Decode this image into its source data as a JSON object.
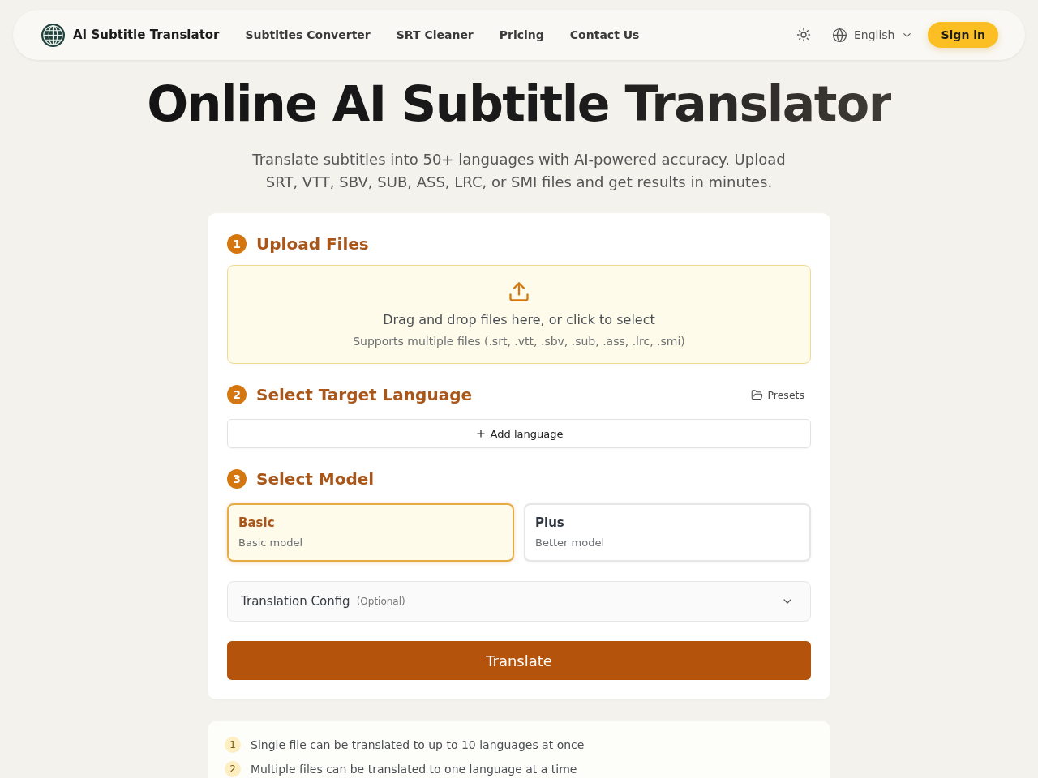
{
  "header": {
    "brand": "AI Subtitle Translator",
    "nav": [
      "Subtitles Converter",
      "SRT Cleaner",
      "Pricing",
      "Contact Us"
    ],
    "language": "English",
    "sign_in": "Sign in"
  },
  "hero": {
    "title": "Online AI Subtitle Translator",
    "subtitle": "Translate subtitles into 50+ languages with AI-powered accuracy. Upload SRT, VTT, SBV, SUB, ASS, LRC, or SMI files and get results in minutes."
  },
  "upload": {
    "number": "1",
    "title": "Upload Files",
    "prompt": "Drag and drop files here, or click to select",
    "hint": "Supports multiple files (.srt, .vtt, .sbv, .sub, .ass, .lrc, .smi)"
  },
  "target_language": {
    "number": "2",
    "title": "Select Target Language",
    "presets": "Presets",
    "add_button": "Add language"
  },
  "model": {
    "number": "3",
    "title": "Select Model",
    "options": [
      {
        "name": "Basic",
        "description": "Basic model",
        "selected": true
      },
      {
        "name": "Plus",
        "description": "Better model",
        "selected": false
      }
    ]
  },
  "config": {
    "label": "Translation Config",
    "note": "(Optional)",
    "expanded": false
  },
  "translate_button": "Translate",
  "tips": [
    {
      "number": "1",
      "text": "Single file can be translated to up to 10 languages at once"
    },
    {
      "number": "2",
      "text": "Multiple files can be translated to one language at a time"
    }
  ]
}
